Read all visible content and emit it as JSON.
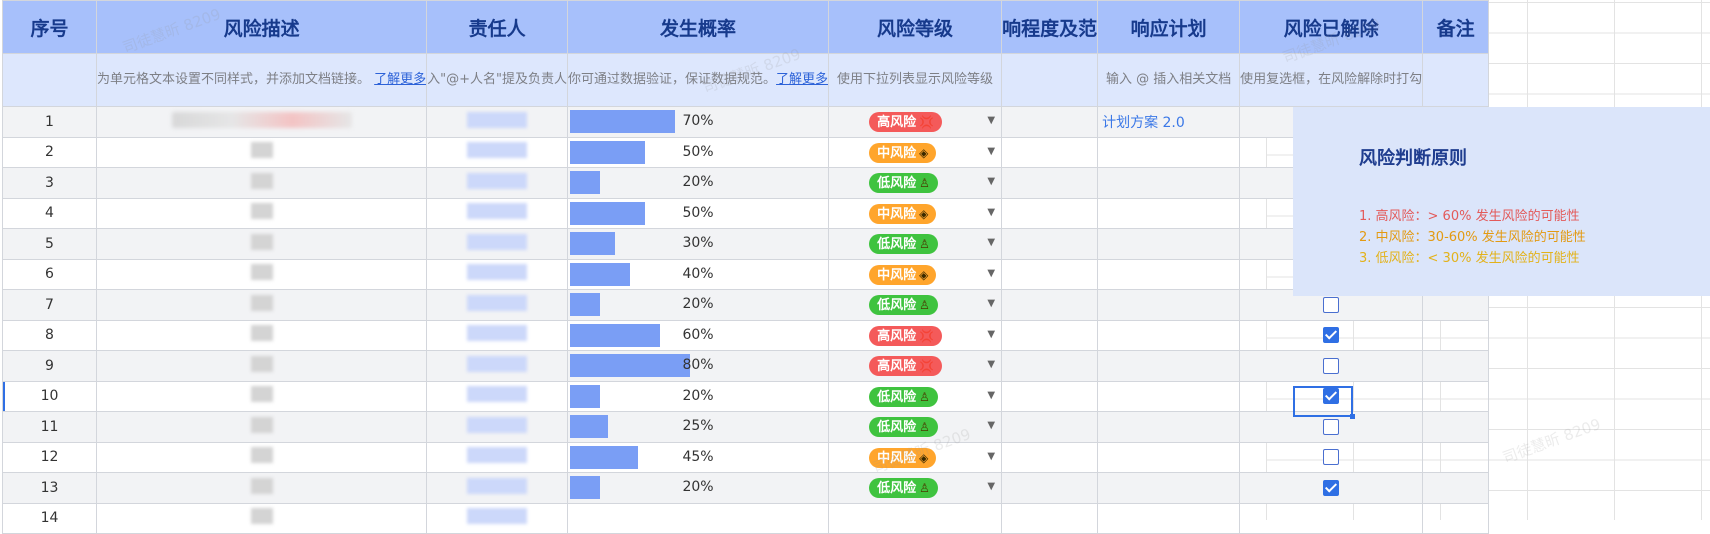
{
  "headers": [
    "序号",
    "风险描述",
    "责任人",
    "发生概率",
    "风险等级",
    "响程度及范",
    "响应计划",
    "风险已解除",
    "备注"
  ],
  "descriptions": {
    "desc": [
      "为单元格文本设置不同样式，并添加文档链接。",
      "了解更多"
    ],
    "owner": "入\"@+人名\"提及负责人",
    "prob": [
      "你可通过数据验证，保证数据规范。",
      "了解更多"
    ],
    "level": "使用下拉列表显示风险等级",
    "plan": "输入 @ 插入相关文档",
    "resolved": "使用复选框，在风险解除时打勾"
  },
  "rows": [
    {
      "num": "1",
      "pct": "70%",
      "p": 70,
      "level": "高风险",
      "cls": "high",
      "plan": "计划方案 2.0",
      "done": true
    },
    {
      "num": "2",
      "pct": "50%",
      "p": 50,
      "level": "中风险",
      "cls": "mid",
      "plan": "",
      "done": false
    },
    {
      "num": "3",
      "pct": "20%",
      "p": 20,
      "level": "低风险",
      "cls": "low",
      "plan": "",
      "done": false
    },
    {
      "num": "4",
      "pct": "50%",
      "p": 50,
      "level": "中风险",
      "cls": "mid",
      "plan": "",
      "done": false
    },
    {
      "num": "5",
      "pct": "30%",
      "p": 30,
      "level": "低风险",
      "cls": "low",
      "plan": "",
      "done": false
    },
    {
      "num": "6",
      "pct": "40%",
      "p": 40,
      "level": "中风险",
      "cls": "mid",
      "plan": "",
      "done": true
    },
    {
      "num": "7",
      "pct": "20%",
      "p": 20,
      "level": "低风险",
      "cls": "low",
      "plan": "",
      "done": false
    },
    {
      "num": "8",
      "pct": "60%",
      "p": 60,
      "level": "高风险",
      "cls": "high",
      "plan": "",
      "done": true
    },
    {
      "num": "9",
      "pct": "80%",
      "p": 80,
      "level": "高风险",
      "cls": "high",
      "plan": "",
      "done": false
    },
    {
      "num": "10",
      "pct": "20%",
      "p": 20,
      "level": "低风险",
      "cls": "low",
      "plan": "",
      "done": true
    },
    {
      "num": "11",
      "pct": "25%",
      "p": 25,
      "level": "低风险",
      "cls": "low",
      "plan": "",
      "done": false
    },
    {
      "num": "12",
      "pct": "45%",
      "p": 45,
      "level": "中风险",
      "cls": "mid",
      "plan": "",
      "done": false
    },
    {
      "num": "13",
      "pct": "20%",
      "p": 20,
      "level": "低风险",
      "cls": "low",
      "plan": "",
      "done": true
    },
    {
      "num": "14",
      "pct": "",
      "p": 0,
      "level": "",
      "cls": "",
      "plan": "",
      "done": false
    }
  ],
  "panel": {
    "title": "风险判断原则",
    "rules": [
      "1. 高风险：> 60% 发生风险的可能性",
      "2. 中风险：30-60% 发生风险的可能性",
      "3. 低风险：< 30% 发生风险的可能性"
    ]
  },
  "watermark": "司徒慧昕 8209",
  "colors": {
    "high": "#f45a5a",
    "mid": "#ffa52c",
    "low": "#3fc33f",
    "bar": "#7a9ef5",
    "header": "#a7c0fb"
  }
}
